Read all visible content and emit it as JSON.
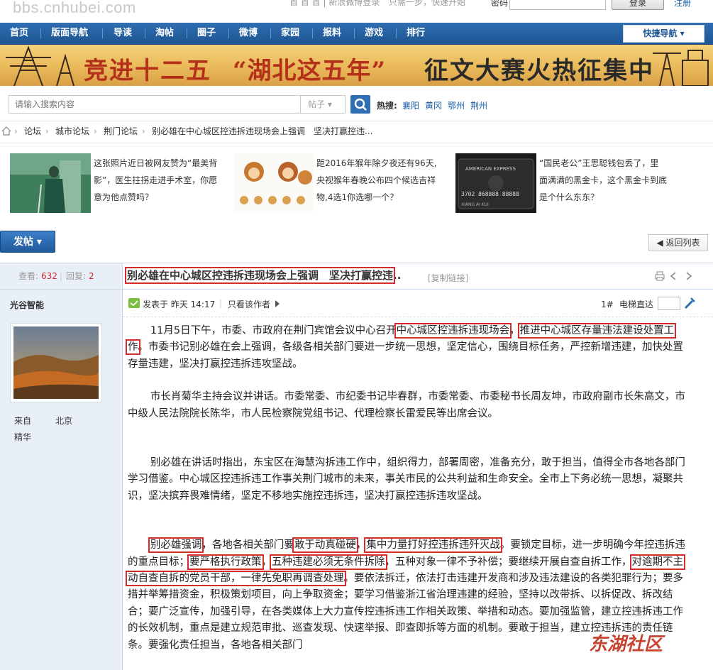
{
  "header": {
    "site_url": "bbs.cnhubei.com",
    "faint_left": "首  首  首 | 新浪微博登录",
    "faint_mid": "只需一步，快速开始",
    "password_label": "密码",
    "login_button": "登录",
    "register_link": "注册"
  },
  "nav": {
    "items": [
      "首页",
      "版面导航",
      "导读",
      "淘帖",
      "圈子",
      "微博",
      "家园",
      "报料",
      "游戏",
      "排行"
    ],
    "quick_nav": "快捷导航 ▾"
  },
  "banner": {
    "title": "竞进十二五",
    "quote": "“湖北这五年”",
    "tail": "征文大赛火热征集中"
  },
  "search": {
    "placeholder": "请输入搜索内容",
    "type": "帖子 ▾",
    "hot_label": "热搜:",
    "hot_links": [
      "襄阳",
      "黄冈",
      "鄂州",
      "荆州"
    ]
  },
  "breadcrumb": {
    "items": [
      "论坛",
      "城市论坛",
      "荆门论坛",
      "别必雄在中心城区控违拆违现场会上强调　坚决打赢控违..."
    ],
    "sep": "›"
  },
  "featured": [
    {
      "text": "这张照片近日被网友赞为“最美背影”，医生拄拐走进手术室，你愿意为他点赞吗？"
    },
    {
      "text": "距2016年猴年除夕夜还有96天,央视猴年春晚公布四个候选吉祥物,4选1你选哪一个？"
    },
    {
      "text": "“国民老公”王思聪钱包丢了，里面满满的黑金卡，这个黑金卡到底是个什么东东？"
    }
  ],
  "actions": {
    "post_button": "发帖 ▾",
    "back_button": "◀ 返回列表"
  },
  "thread": {
    "views_label": "查看:",
    "views": "632",
    "replies_label": "回复:",
    "replies": "2",
    "title": "别必雄在中心城区控违拆违现场会上强调　坚决打赢控违",
    "title_ellipsis": "..",
    "copy_link": "[复制链接]",
    "author": "光谷智能",
    "from_label": "来自",
    "from_value": "北京",
    "essence_label": "精华",
    "posted": "发表于 昨天 14:17",
    "only_author": "只看该作者",
    "floor": "1#",
    "elevator_label": "电梯直达"
  },
  "content": {
    "p1": [
      "11月5日下午，市委、市政府在荆门宾馆会议中心召开",
      "中心城区控违拆违现场会",
      "，",
      "推进中心城区存量违法建设处置工作",
      "。市委书记别必雄在会上强调，各级各相关部门要进一步统一思想，坚定信心，围绕目标任务，严控新增违建，加快处置存量违建，坚决打赢控违拆违攻坚战。"
    ],
    "p2": "市长肖菊华主持会议并讲话。市委常委、市纪委书记毕春群，市委常委、市委秘书长周友坤，市政府副市长朱高文，市中级人民法院院长陈华，市人民检察院党组书记、代理检察长雷爱民等出席会议。",
    "p3": "别必雄在讲话时指出，东宝区在海慧沟拆违工作中，组织得力，部署周密，准备充分，敢于担当，值得全市各地各部门学习借鉴。中心城区控违拆违工作事关荆门城市的未来，事关市民的公共利益和生命安全。全市上下务必统一思想，凝聚共识，坚决摈弃畏难情绪，坚定不移地实施控违拆违，坚决打赢控违拆违攻坚战。",
    "p4": [
      "别必雄强调",
      "，各地各相关部门要",
      "敢于动真碰硬",
      "，",
      "集中力量打好控违拆违歼灭战",
      "。要锁定目标，进一步明确今年控违拆违的重点目标；",
      "要严格执行政策",
      "，",
      "五种违建必须无条件拆除",
      "，五种对象一律不予补偿；要继续开展自查自拆工作，",
      "对逾期不主动自查自拆的党员干部，一律先免职再调查处理",
      "。要依法拆迁，依法打击违建开发商和涉及违法建设的各类犯罪行为；要多措并举筹措资金，积极策划项目，向上争取资金；要学习借鉴浙江省治理违建的经验，坚持以改带拆、以拆促改、拆改结合；要广泛宣传，加强引导，在各类媒体上大力宣传控违拆违工作相关政策、举措和动态。要加强监管，建立控违拆违工作的长效机制，重点是建立规范审批、巡查发现、快速举报、即查即拆等方面的机制。要敢于担当，建立控违拆违的责任链条。要强化责任担当，各地各相关部门"
    ]
  },
  "watermark": "东湖社区",
  "colors": {
    "nav": "#1d5592",
    "accent": "#2f6eb2",
    "highlight_box": "#d42b2b",
    "sidebar": "#e8eff7"
  }
}
